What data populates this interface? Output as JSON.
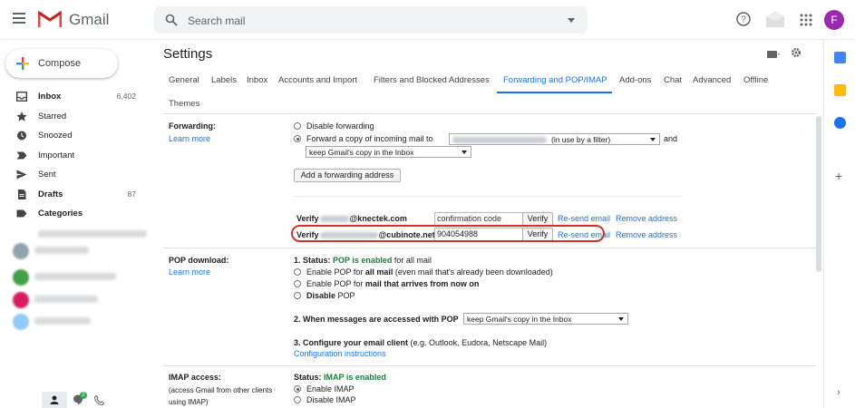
{
  "header": {
    "app_name": "Gmail",
    "search_placeholder": "Search mail",
    "avatar_letter": "F"
  },
  "colors": {
    "accent": "#1a73e8",
    "gmail_red": "#ea4335",
    "status_green": "#188038",
    "highlight_red": "#d93025",
    "avatar": "#9c27b0"
  },
  "sidebar": {
    "compose_label": "Compose",
    "items": [
      {
        "label": "Inbox",
        "count": "6,402",
        "icon": "inbox-icon",
        "bold": true
      },
      {
        "label": "Starred",
        "count": "",
        "icon": "star-icon",
        "bold": false
      },
      {
        "label": "Snoozed",
        "count": "",
        "icon": "clock-icon",
        "bold": false
      },
      {
        "label": "Important",
        "count": "",
        "icon": "important-icon",
        "bold": false
      },
      {
        "label": "Sent",
        "count": "",
        "icon": "send-icon",
        "bold": false
      },
      {
        "label": "Drafts",
        "count": "87",
        "icon": "draft-icon",
        "bold": true
      },
      {
        "label": "Categories",
        "count": "",
        "icon": "label-icon",
        "bold": true
      }
    ]
  },
  "settings": {
    "title": "Settings",
    "tabs": [
      "General",
      "Labels",
      "Inbox",
      "Accounts and Import",
      "Filters and Blocked Addresses",
      "Forwarding and POP/IMAP",
      "Add-ons",
      "Chat",
      "Advanced",
      "Offline",
      "Themes"
    ],
    "active_tab": "Forwarding and POP/IMAP",
    "forwarding": {
      "label": "Forwarding:",
      "learn_more": "Learn more",
      "disable": "Disable forwarding",
      "forward_prefix": "Forward a copy of incoming mail to",
      "forward_status": "(in use by a filter)",
      "and": "and",
      "keep_option": "keep Gmail's copy in the Inbox",
      "add_button": "Add a forwarding address",
      "verify_rows": [
        {
          "prefix": "Verify",
          "domain": "@knectek.com",
          "code": "confirmation code",
          "verify": "Verify",
          "resend": "Re-send email",
          "remove": "Remove address"
        },
        {
          "prefix": "Verify",
          "domain": "@cubinote.net",
          "code": "904054988",
          "verify": "Verify",
          "resend": "Re-send email",
          "remove": "Remove address"
        }
      ]
    },
    "pop": {
      "label": "POP download:",
      "learn_more": "Learn more",
      "status_prefix": "1. Status:",
      "status_value": "POP is enabled",
      "status_suffix": "for all mail",
      "opt1_a": "Enable POP for",
      "opt1_b": "all mail",
      "opt1_c": "(even mail that's already been downloaded)",
      "opt2_a": "Enable POP for",
      "opt2_b": "mail that arrives from now on",
      "opt3_a": "Disable",
      "opt3_b": "POP",
      "step2": "2. When messages are accessed with POP",
      "step2_select": "keep Gmail's copy in the Inbox",
      "step3": "3. Configure your email client",
      "step3_note": "(e.g. Outlook, Eudora, Netscape Mail)",
      "config_link": "Configuration instructions"
    },
    "imap": {
      "label": "IMAP access:",
      "note1": "(access Gmail from other clients",
      "note2": "using IMAP)",
      "status_prefix": "Status:",
      "status_value": "IMAP is enabled",
      "enable": "Enable IMAP",
      "disable": "Disable IMAP"
    }
  },
  "bottom_badge": "2"
}
